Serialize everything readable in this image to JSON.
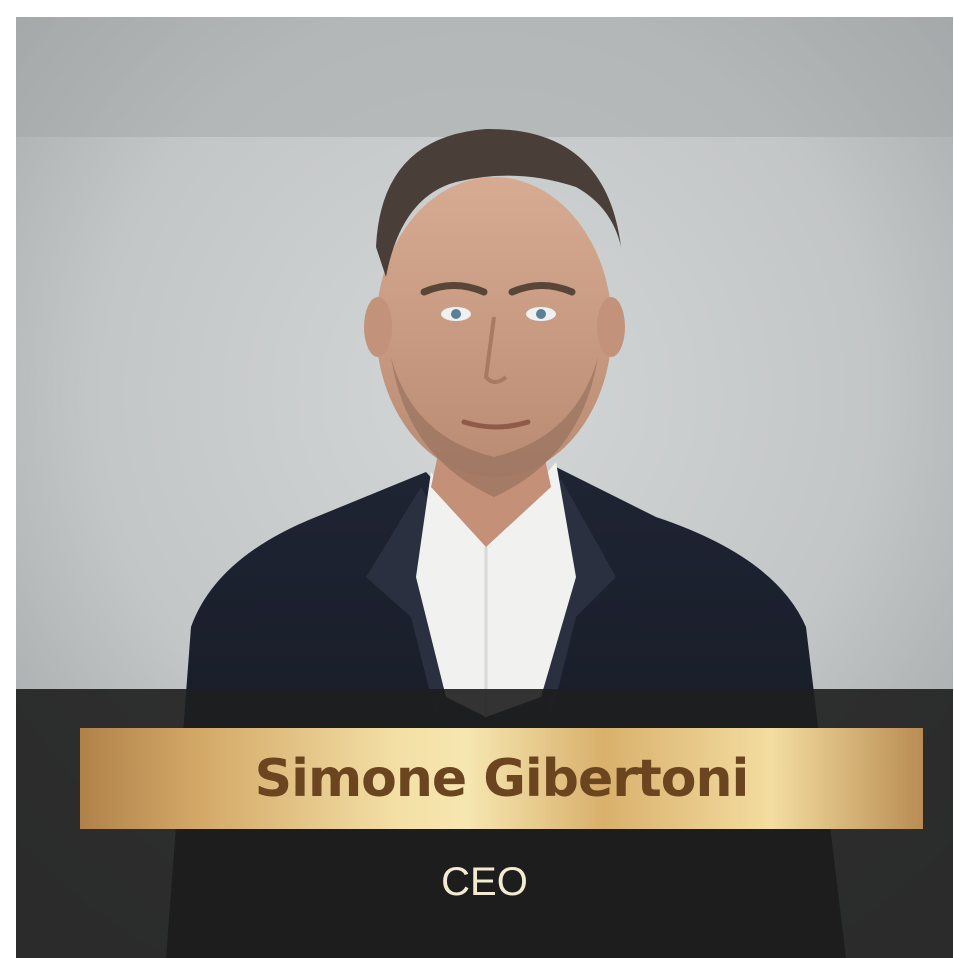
{
  "profile": {
    "name": "Simone Gibertoni",
    "role": "CEO"
  },
  "colors": {
    "overlay": "#1e1e1e",
    "banner_gold_light": "#f6e6b0",
    "banner_gold_dark": "#b0824a",
    "name_text": "#6b4420",
    "role_text": "#f3ead2"
  }
}
